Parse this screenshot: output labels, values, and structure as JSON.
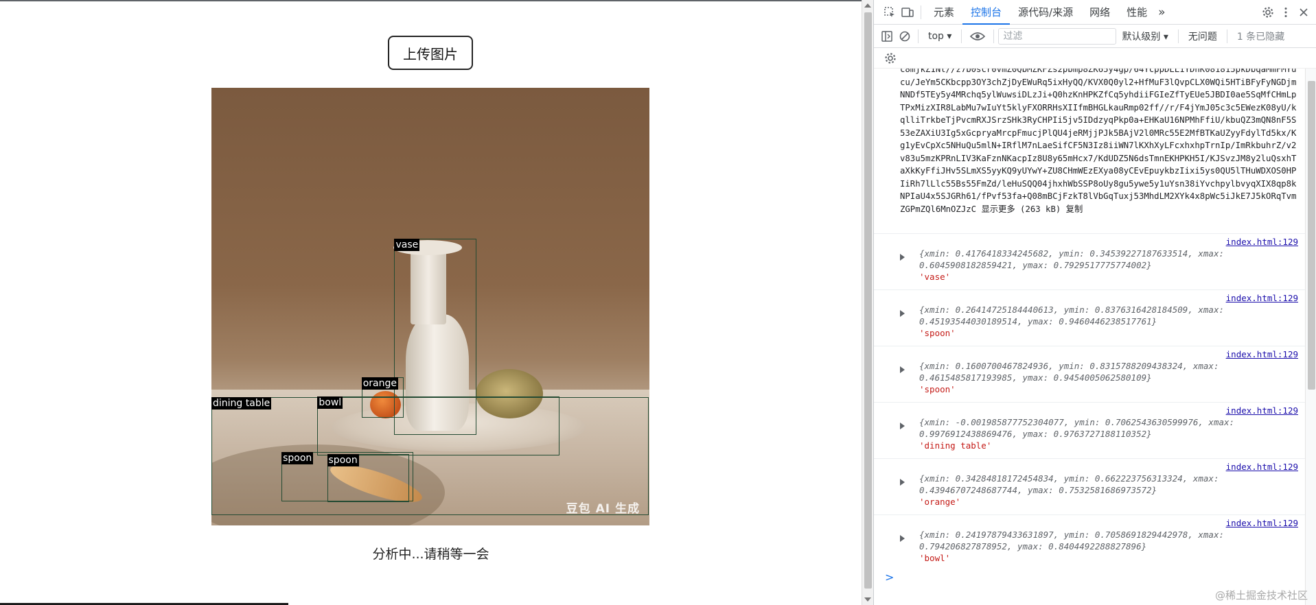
{
  "page": {
    "upload_button": "上传图片",
    "status": "分析中...请稍等一会",
    "watermark": "豆包 AI 生成"
  },
  "detections": [
    {
      "label": "vase",
      "xmin": 0.4176418334245682,
      "ymin": 0.34539227187633514,
      "xmax": 0.6045908182859421,
      "ymax": 0.7929517775774002
    },
    {
      "label": "orange",
      "xmin": 0.34284818172454834,
      "ymin": 0.662223756313324,
      "xmax": 0.43946707248687744,
      "ymax": 0.7532581686973572
    },
    {
      "label": "dining table",
      "xmin": -0.001985877752304077,
      "ymin": 0.7062543630599976,
      "xmax": 0.9976912438869476,
      "ymax": 0.9763727188110352
    },
    {
      "label": "bowl",
      "xmin": 0.24197879433631897,
      "ymin": 0.7058691829442978,
      "xmax": 0.794206827878952,
      "ymax": 0.8404492288827896
    },
    {
      "label": "spoon",
      "xmin": 0.1600700467824936,
      "ymin": 0.8315788209438324,
      "xmax": 0.4615485817193985,
      "ymax": 0.9454005062580109
    },
    {
      "label": "spoon",
      "xmin": 0.26414725184440613,
      "ymin": 0.8376316428184509,
      "xmax": 0.4519354403018951,
      "ymax": 0.9460446238517761
    }
  ],
  "devtools": {
    "tabs": [
      "元素",
      "控制台",
      "源代码/来源",
      "网络",
      "性能"
    ],
    "active_tab": "控制台",
    "more_tabs": "»",
    "context": "top",
    "filter_placeholder": "过滤",
    "level": "默认级别 ▾",
    "issues": "无问题",
    "hidden": "1 条已隐藏",
    "prompt": ">",
    "base64_text": "c8mjkZ1Nt//z7b0scr0vmZ0QbMZKFZs2pbmp8ZK65y4gp/64YcppDLL1YDhK081815pkDbqaMmFMYucu/JeYm5CKbcpp3OY3chZjDyEWuRq5ixHyQQ/KVX0Q0yl2+HfMuF3lQvpCLX0WQi5HTiBFyFyNGDjmNNDf5TEy5y4MRchq5ylWuwsiDLzJi+Q0hzKnHPKZfCq5yhdiiFGIeZfTyEUe5JBDI0ae5SqMfCHmLpTPxMizXIR8LabMu7wIuYt5klyFXORRHsXIIfmBHGLkauRmp02ff//r/F4jYmJ05c3c5EWezK08yU/kqlliTrkbeTjPvcmRXJSrzSHk3RyCHPIi5jv5IDdzyqPkp0a+EHKaU16NPMhFfiU/kbuQZ3mQN8nF5S53eZAXiU3Ig5xGcpryaMrcpFmucjPlQU4jeRMjjPJk5BAjV2l0MRc55E2MfBTKaUZyyFdylTd5kx/Kg1yEvCpXc5NHuQu5mlN+IRflM7nLaeSifCF5N3Iz8iiWN7lKXhXyLFcxhxhpTrnIp/ImRkbuhrZ/v2v83u5mzKPRnLIV3KaFznNKacpIz8U8y65mHcx7/KdUDZ5N6dsTmnEKHPKH5I/KJSvzJM8y2luQsxhTaXkKyFfiJHv5SLmXS5yyKQ9yUYwY+ZU8CHmWEzEXya08yCEvEpuykbzIixi5ys0QU5lTHuWDXOS0HPIiRh7lLlc55Bs55FmZd/leHuSQQ04jhxhWbSSP8oUy8gu5ywe5y1uYsn38iYvchpylbvyqXIX8qp8kNPIaU4x5SJGRh61/fPvf53fa+Q08mBCjFzkT8lVbGqTuxj53MhdLM2XYk4x8pWc5iJkE7J5kORqTvmZGPmZQl6MnOZJzC 显示更多 (263 kB)  复制",
    "entries": [
      {
        "src": "index.html:129",
        "obj": "{xmin: 0.4176418334245682, ymin: 0.34539227187633514, xmax: 0.6045908182859421, ymax: 0.7929517775774002}",
        "str": "'vase'"
      },
      {
        "src": "index.html:129",
        "obj": "{xmin: 0.26414725184440613, ymin: 0.8376316428184509, xmax: 0.4519354403018951​4, ymax: 0.9460446238517761}",
        "str": "'spoon'"
      },
      {
        "src": "index.html:129",
        "obj": "{xmin: 0.1600700467824936, ymin: 0.8315788209438324, xmax: 0.4615485817193985, ymax: 0.9454005062580109}",
        "str": "'spoon'"
      },
      {
        "src": "index.html:129",
        "obj": "{xmin: -0.001985877752304077, ymin: 0.7062543630599976, xmax: 0.9976912438869476, ymax: 0.9763727188110352}",
        "str": "'dining table'"
      },
      {
        "src": "index.html:129",
        "obj": "{xmin: 0.34284818172454834, ymin: 0.662223756313324, xmax: 0.43946707248687744, ymax: 0.7532581686973572}",
        "str": "'orange'"
      },
      {
        "src": "index.html:129",
        "obj": "{xmin: 0.24197879433631897, ymin: 0.7058691829442978, xmax: 0.794206827878952, ymax: 0.8404492288827896}",
        "str": "'bowl'"
      }
    ],
    "site_mark": "@稀土掘金技术社区"
  },
  "colors": {
    "accent": "#1a73e8",
    "bbox": "#234a32",
    "string": "#c41a16"
  },
  "icons": [
    "inspect-icon",
    "device-toolbar-icon",
    "settings-icon",
    "more-vert-icon",
    "sidebar-icon",
    "clear-icon",
    "eye-icon"
  ]
}
